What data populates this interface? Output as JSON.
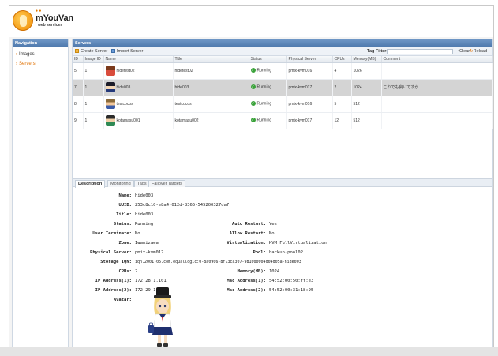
{
  "app": {
    "logo_text": "mYouVan",
    "logo_sub": "web services"
  },
  "sidebar": {
    "title": "Navigation",
    "items": [
      {
        "label": "Images",
        "active": false
      },
      {
        "label": "Servers",
        "active": true
      }
    ]
  },
  "main": {
    "title": "Servers",
    "toolbar": {
      "create_label": "Create Server",
      "import_label": "Import Server",
      "tag_filter_label": "Tag Filter:",
      "tag_filter_value": "",
      "clear_label": "Clear",
      "reload_label": "Reload"
    },
    "columns": [
      "ID",
      "Image ID",
      "Name",
      "Title",
      "Status",
      "Physical Server",
      "CPUs",
      "Memory(MB)",
      "Comment"
    ],
    "rows": [
      {
        "id": "5",
        "image_id": "1",
        "name": "hidetest02",
        "title": "hidetest02",
        "status": "Running",
        "physical_server": "pmix-kvm016",
        "cpus": "4",
        "memory": "1026",
        "comment": "",
        "selected": false
      },
      {
        "id": "7",
        "image_id": "1",
        "name": "hide003",
        "title": "hide003",
        "status": "Running",
        "physical_server": "pmix-kvm017",
        "cpus": "2",
        "memory": "1024",
        "comment": "これでも良いですか",
        "selected": true
      },
      {
        "id": "8",
        "image_id": "1",
        "name": "testcocos",
        "title": "testcocos",
        "status": "Running",
        "physical_server": "pmix-kvm016",
        "cpus": "5",
        "memory": "512",
        "comment": "",
        "selected": false
      },
      {
        "id": "9",
        "image_id": "1",
        "name": "kotamasu001",
        "title": "kotamasu002",
        "status": "Running",
        "physical_server": "pmix-kvm017",
        "cpus": "12",
        "memory": "512",
        "comment": "",
        "selected": false
      }
    ],
    "tabs": [
      "Description",
      "Monitoring",
      "Tags",
      "Failover Targets"
    ],
    "detail": {
      "name_label": "Name:",
      "name": "hide003",
      "uuid_label": "UUID:",
      "uuid": "253c8c10-e8a4-012d-8365-545200327da7",
      "title_label": "Title:",
      "title": "hide003",
      "status_label": "Status:",
      "status": "Running",
      "user_terminate_label": "User Terminate:",
      "user_terminate": "No",
      "zone_label": "Zone:",
      "zone": "Iwamizawa",
      "physical_server_label": "Physical Server:",
      "physical_server": "pmix-kvm017",
      "storage_label": "Storage IQN:",
      "storage": "iqn.2001-05.com.equallogic:0-8a0906-8f73ca307-981000004d04d05a-hide003",
      "cpus_label": "CPUs:",
      "cpus": "2",
      "ip1_label": "IP Address(1):",
      "ip1": "172.28.1.101",
      "ip2_label": "IP Address(2):",
      "ip2": "172.29.1.101",
      "avatar_label": "Avatar:",
      "auto_restart_label": "Auto Restart:",
      "auto_restart": "Yes",
      "allow_restart_label": "Allow Restart:",
      "allow_restart": "No",
      "virtualization_label": "Virtualization:",
      "virtualization": "KVM FullVirtualization",
      "pool_label": "Pool:",
      "pool": "backup-pool02",
      "memory_label": "Memory(MB):",
      "memory": "1024",
      "mac1_label": "Mac Address(1):",
      "mac1": "54:52:00:50:ff:e3",
      "mac2_label": "Mac Address(2):",
      "mac2": "54:52:00:31:18:95"
    }
  },
  "colors": {
    "panel_header": "#5b84b8",
    "accent_orange": "#e07000",
    "status_green": "#3aa23a",
    "selected_row": "#d4d4d4"
  }
}
